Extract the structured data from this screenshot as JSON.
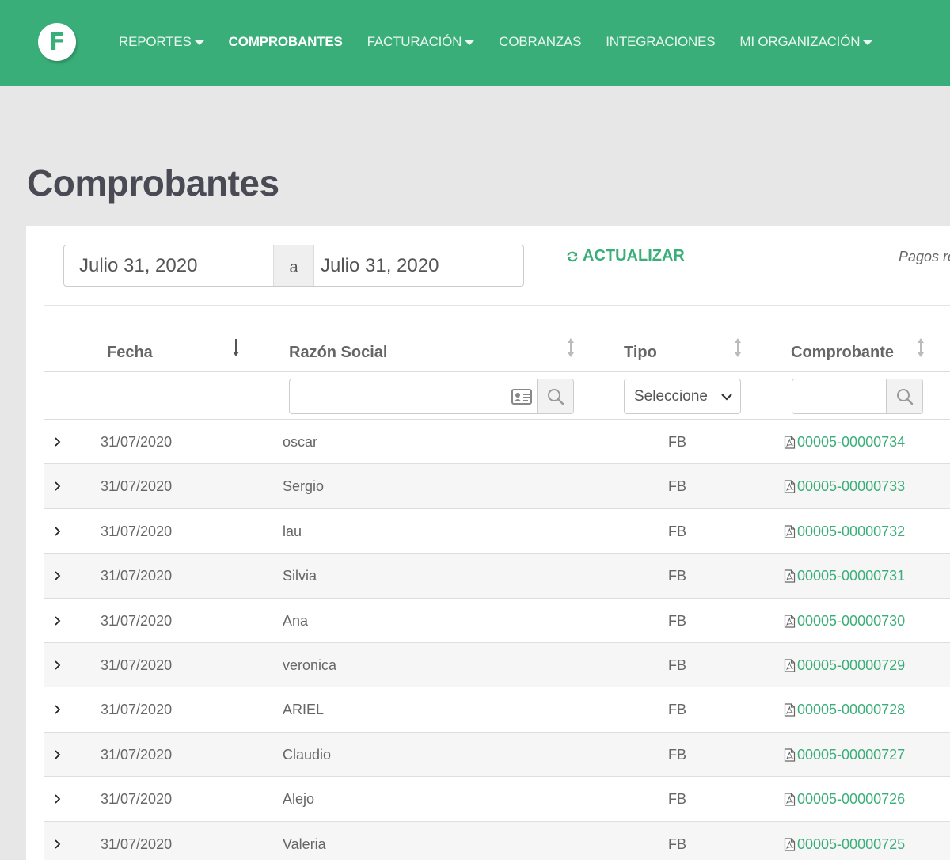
{
  "app": {
    "logo_letter": "F",
    "brand_color": "#3aae78"
  },
  "nav": {
    "items": [
      {
        "label": "REPORTES",
        "dropdown": true,
        "active": false
      },
      {
        "label": "COMPROBANTES",
        "dropdown": false,
        "active": true
      },
      {
        "label": "FACTURACIÓN",
        "dropdown": true,
        "active": false
      },
      {
        "label": "COBRANZAS",
        "dropdown": false,
        "active": false
      },
      {
        "label": "INTEGRACIONES",
        "dropdown": false,
        "active": false
      },
      {
        "label": "MI ORGANIZACIÓN",
        "dropdown": true,
        "active": false
      }
    ]
  },
  "page": {
    "title": "Comprobantes"
  },
  "toolbar": {
    "date_from": "Julio 31, 2020",
    "date_separator": "a",
    "date_to": "Julio 31, 2020",
    "refresh_label": "ACTUALIZAR",
    "pagos_label": "Pagos re"
  },
  "table": {
    "columns": {
      "fecha": "Fecha",
      "razon_social": "Razón Social",
      "tipo": "Tipo",
      "comprobante": "Comprobante"
    },
    "filters": {
      "tipo_selected": "Seleccione"
    },
    "rows": [
      {
        "fecha": "31/07/2020",
        "razon_social": "oscar",
        "tipo": "FB",
        "comprobante": "00005-00000734"
      },
      {
        "fecha": "31/07/2020",
        "razon_social": "Sergio",
        "tipo": "FB",
        "comprobante": "00005-00000733"
      },
      {
        "fecha": "31/07/2020",
        "razon_social": "lau",
        "tipo": "FB",
        "comprobante": "00005-00000732"
      },
      {
        "fecha": "31/07/2020",
        "razon_social": "Silvia",
        "tipo": "FB",
        "comprobante": "00005-00000731"
      },
      {
        "fecha": "31/07/2020",
        "razon_social": "Ana",
        "tipo": "FB",
        "comprobante": "00005-00000730"
      },
      {
        "fecha": "31/07/2020",
        "razon_social": "veronica",
        "tipo": "FB",
        "comprobante": "00005-00000729"
      },
      {
        "fecha": "31/07/2020",
        "razon_social": "ARIEL",
        "tipo": "FB",
        "comprobante": "00005-00000728"
      },
      {
        "fecha": "31/07/2020",
        "razon_social": "Claudio",
        "tipo": "FB",
        "comprobante": "00005-00000727"
      },
      {
        "fecha": "31/07/2020",
        "razon_social": "Alejo",
        "tipo": "FB",
        "comprobante": "00005-00000726"
      },
      {
        "fecha": "31/07/2020",
        "razon_social": "Valeria",
        "tipo": "FB",
        "comprobante": "00005-00000725"
      }
    ]
  }
}
